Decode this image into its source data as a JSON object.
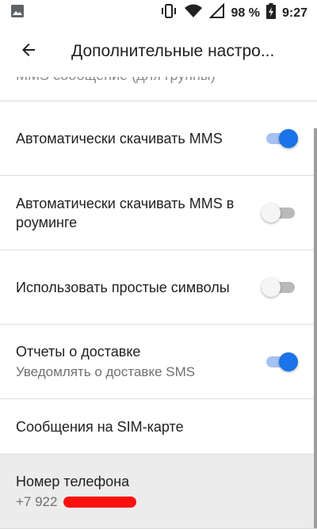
{
  "status": {
    "battery": "98 %",
    "time": "9:27"
  },
  "appbar": {
    "title": "Дополнительные настро..."
  },
  "list": {
    "cutoff_text": "MMS сообщение (для группы)",
    "items": [
      {
        "title": "Автоматически скачивать MMS",
        "toggle": "on"
      },
      {
        "title": "Автоматически скачивать MMS в роуминге",
        "toggle": "off"
      },
      {
        "title": "Использовать простые символы",
        "toggle": "off"
      },
      {
        "title": "Отчеты о доставке",
        "subtitle": "Уведомлять о доставке SMS",
        "toggle": "on"
      },
      {
        "title": "Сообщения на SIM-карте"
      },
      {
        "title": "Номер телефона",
        "subtitle": "+7 922"
      }
    ]
  },
  "icons": {
    "status_left": "image-icon",
    "vibrate": "vibrate-icon",
    "wifi": "wifi-icon",
    "signal": "signal-icon",
    "battery": "battery-charging-icon",
    "back": "arrow-back-icon"
  },
  "colors": {
    "accent": "#1a73e8",
    "accent_track": "#a6c1f2",
    "redaction": "#ff1010"
  }
}
